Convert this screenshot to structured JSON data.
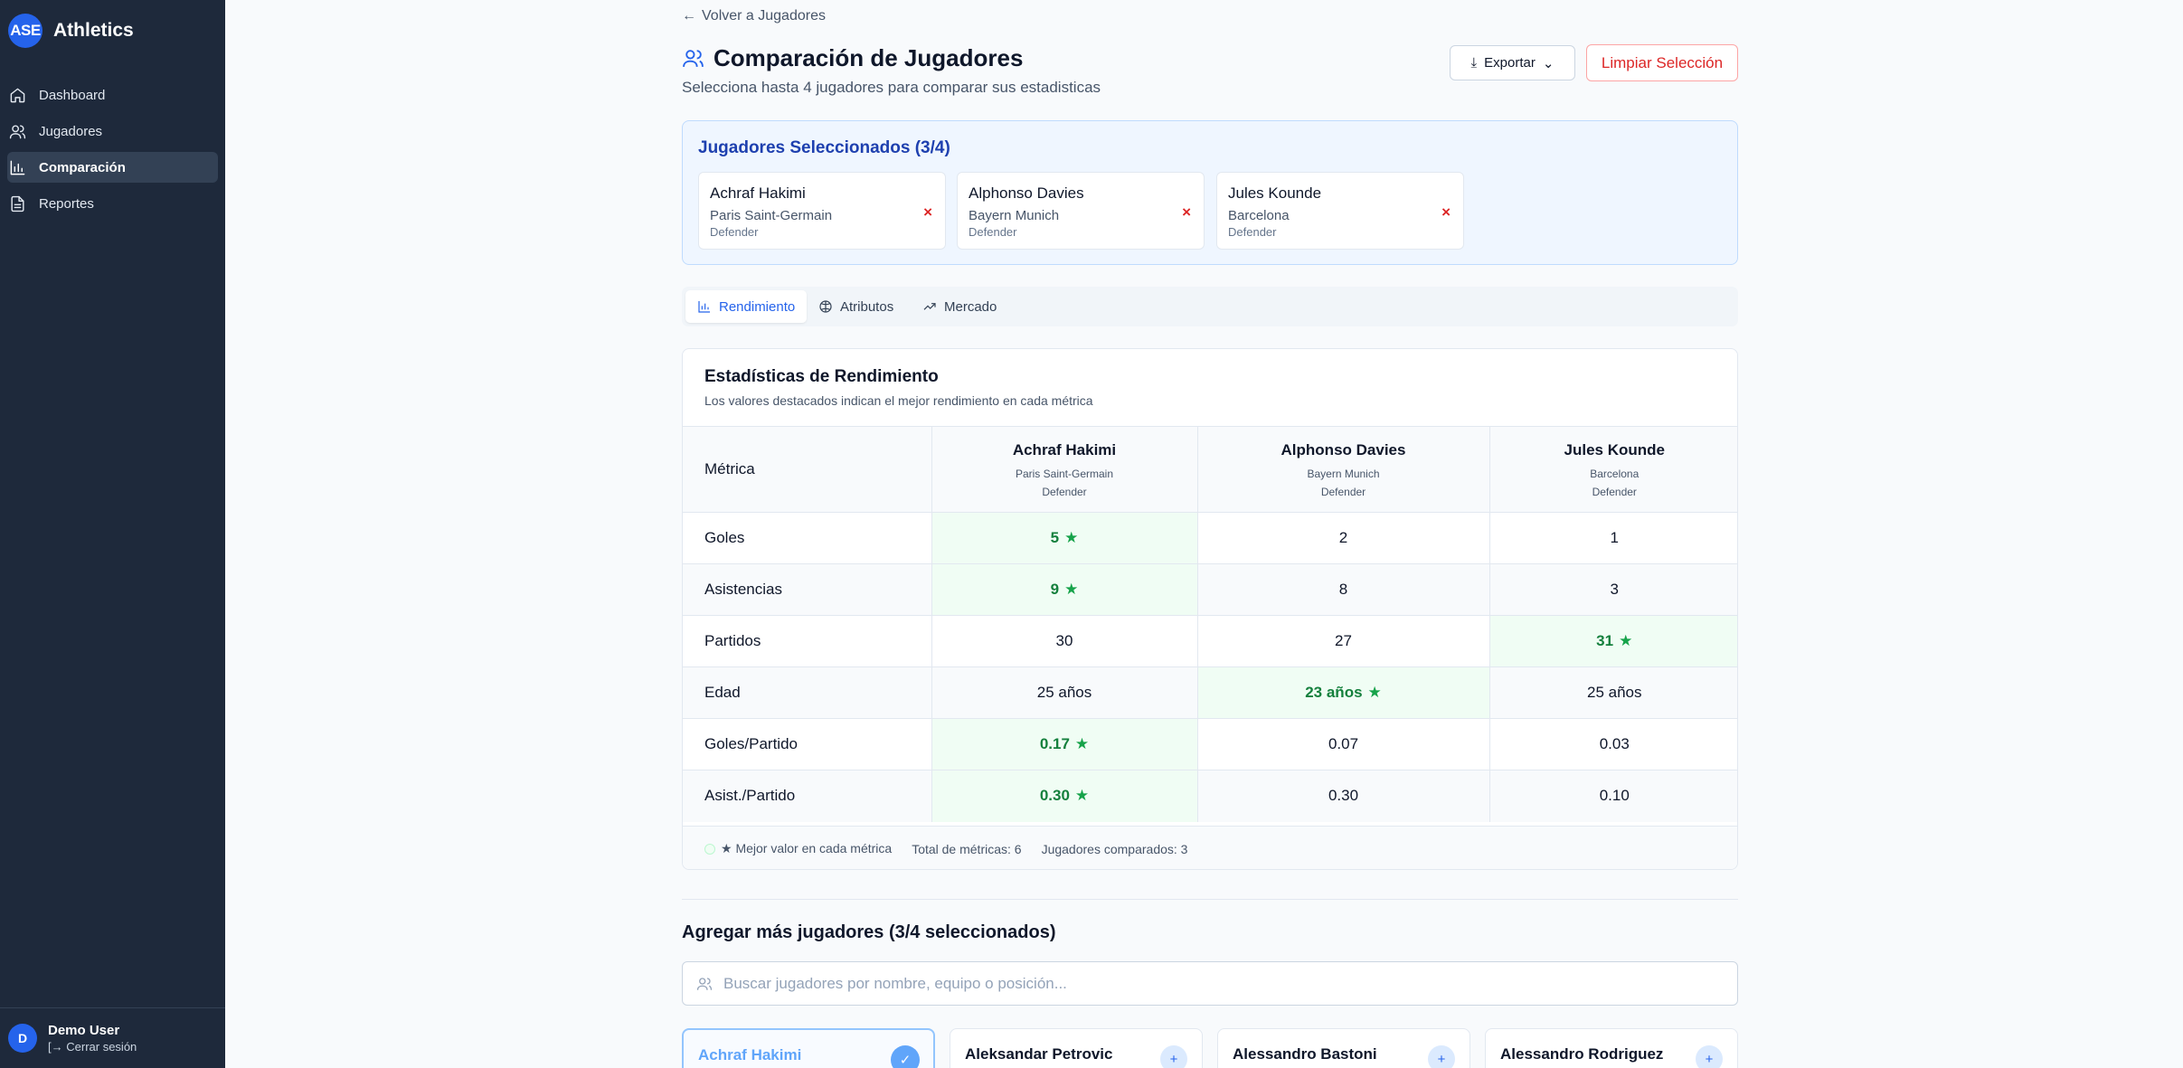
{
  "app": {
    "logo": "ASE",
    "name": "Athletics"
  },
  "sidebar": {
    "items": [
      {
        "label": "Dashboard",
        "icon": "home-icon",
        "active": false
      },
      {
        "label": "Jugadores",
        "icon": "users-icon",
        "active": false
      },
      {
        "label": "Comparación",
        "icon": "bar-chart-icon",
        "active": true
      },
      {
        "label": "Reportes",
        "icon": "document-icon",
        "active": false
      }
    ],
    "user": {
      "initial": "D",
      "name": "Demo User",
      "logout": "Cerrar sesión"
    }
  },
  "header": {
    "back": "Volver a Jugadores",
    "title": "Comparación de Jugadores",
    "subtitle": "Selecciona hasta 4 jugadores para comparar sus estadisticas",
    "export_label": "Exportar",
    "clear_label": "Limpiar Selección"
  },
  "selected": {
    "title": "Jugadores Seleccionados (3/4)",
    "players": [
      {
        "name": "Achraf Hakimi",
        "team": "Paris Saint-Germain",
        "position": "Defender"
      },
      {
        "name": "Alphonso Davies",
        "team": "Bayern Munich",
        "position": "Defender"
      },
      {
        "name": "Jules Kounde",
        "team": "Barcelona",
        "position": "Defender"
      }
    ]
  },
  "tabs": [
    {
      "label": "Rendimiento",
      "icon": "bar-chart-icon",
      "active": true
    },
    {
      "label": "Atributos",
      "icon": "ball-icon",
      "active": false
    },
    {
      "label": "Mercado",
      "icon": "trending-up-icon",
      "active": false
    }
  ],
  "stats": {
    "title": "Estadísticas de Rendimiento",
    "subtitle": "Los valores destacados indican el mejor rendimiento en cada métrica",
    "metric_header": "Métrica",
    "players": [
      {
        "name": "Achraf Hakimi",
        "team": "Paris Saint-Germain",
        "position": "Defender"
      },
      {
        "name": "Alphonso Davies",
        "team": "Bayern Munich",
        "position": "Defender"
      },
      {
        "name": "Jules Kounde",
        "team": "Barcelona",
        "position": "Defender"
      }
    ],
    "rows": [
      {
        "metric": "Goles",
        "values": [
          "5",
          "2",
          "1"
        ],
        "best": [
          true,
          false,
          false
        ]
      },
      {
        "metric": "Asistencias",
        "values": [
          "9",
          "8",
          "3"
        ],
        "best": [
          true,
          false,
          false
        ]
      },
      {
        "metric": "Partidos",
        "values": [
          "30",
          "27",
          "31"
        ],
        "best": [
          false,
          false,
          true
        ]
      },
      {
        "metric": "Edad",
        "values": [
          "25 años",
          "23 años",
          "25 años"
        ],
        "best": [
          false,
          true,
          false
        ]
      },
      {
        "metric": "Goles/Partido",
        "values": [
          "0.17",
          "0.07",
          "0.03"
        ],
        "best": [
          true,
          false,
          false
        ]
      },
      {
        "metric": "Asist./Partido",
        "values": [
          "0.30",
          "0.30",
          "0.10"
        ],
        "best": [
          true,
          false,
          false
        ]
      }
    ],
    "best_marker": "★",
    "footer": {
      "legend": "★ Mejor valor en cada métrica",
      "total": "Total de métricas: 6",
      "compared": "Jugadores comparados: 3"
    }
  },
  "add": {
    "title": "Agregar más jugadores (3/4 seleccionados)",
    "search_placeholder": "Buscar jugadores por nombre, equipo o posición...",
    "players": [
      {
        "name": "Achraf Hakimi",
        "selected": true,
        "action": "✓"
      },
      {
        "name": "Aleksandar Petrovic",
        "selected": false,
        "action": "+"
      },
      {
        "name": "Alessandro Bastoni",
        "selected": false,
        "action": "+"
      },
      {
        "name": "Alessandro Rodriguez",
        "selected": false,
        "action": "+"
      }
    ]
  },
  "colors": {
    "sidebar_bg": "#1e293b",
    "accent": "#2563eb",
    "best_bg": "#f0fdf4",
    "best_text": "#15803d",
    "danger": "#dc2626"
  }
}
